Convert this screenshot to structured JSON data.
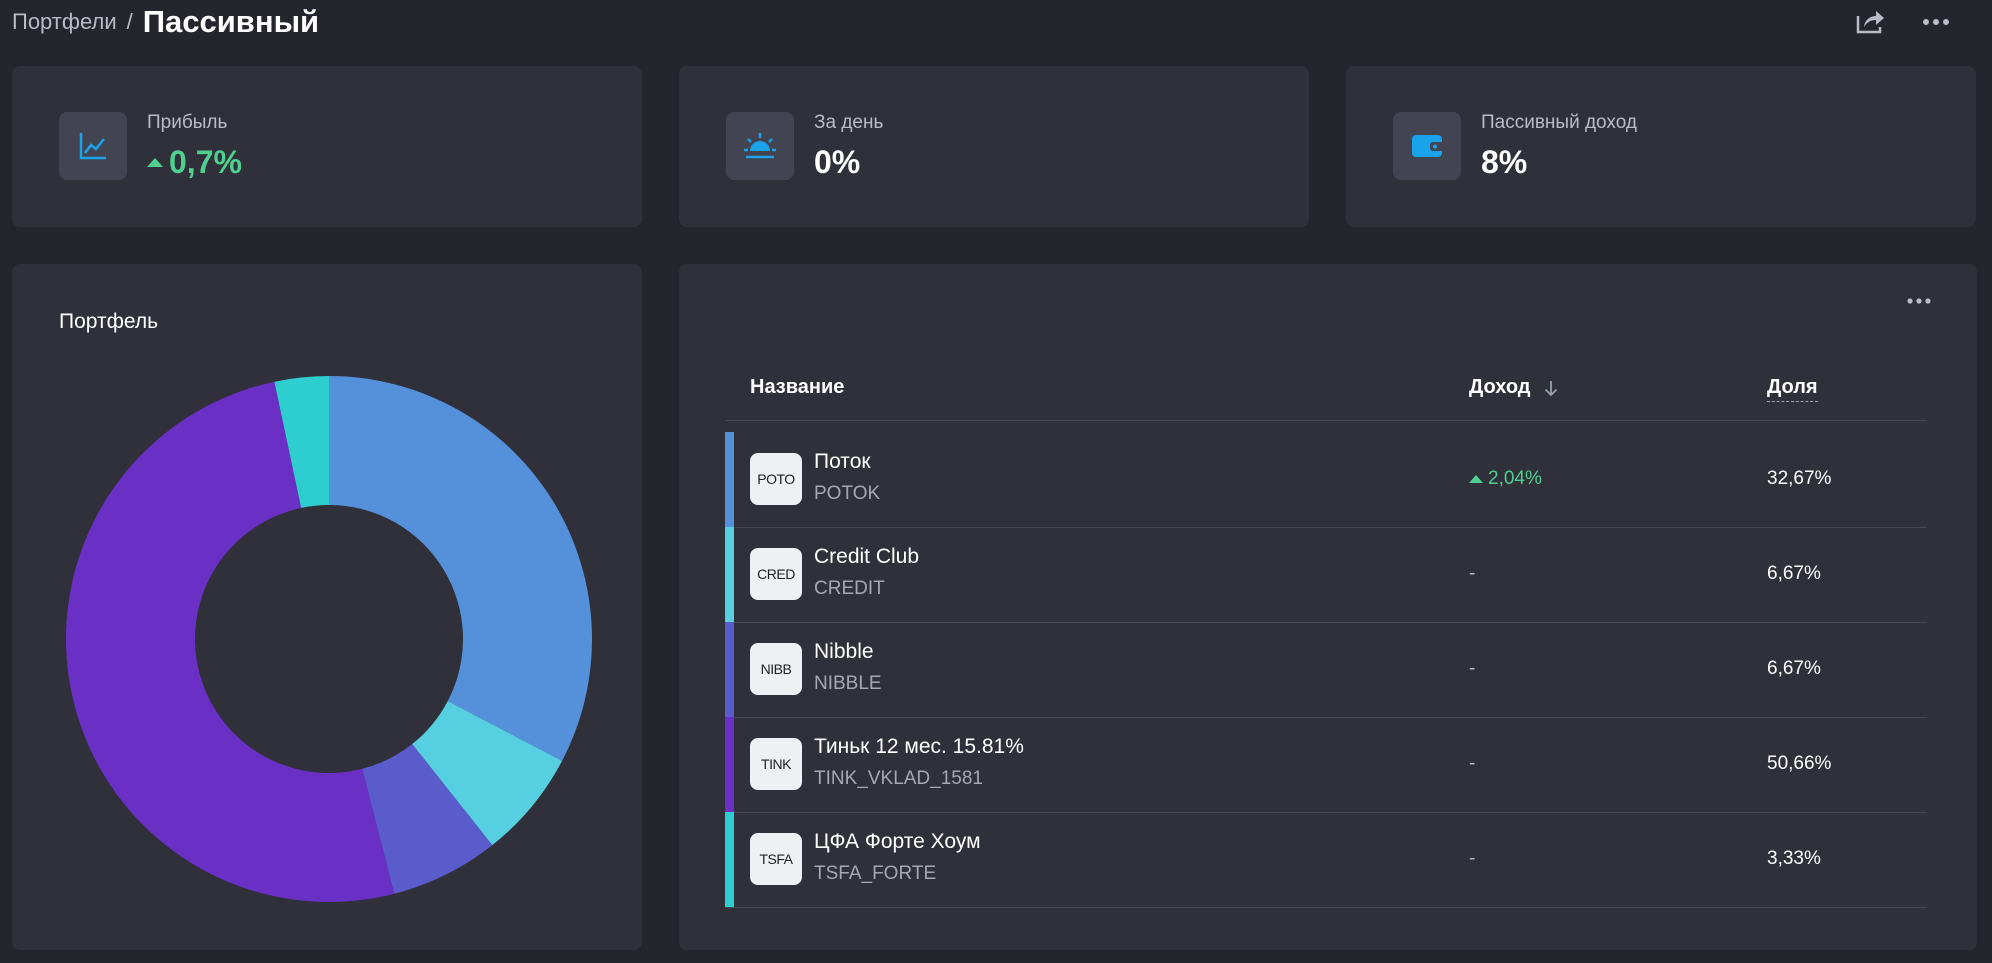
{
  "breadcrumb": {
    "parent": "Портфели",
    "separator": "/",
    "title": "Пассивный"
  },
  "header_actions": [
    {
      "name": "share-icon"
    },
    {
      "name": "more-icon"
    }
  ],
  "stats": [
    {
      "label": "Прибыль",
      "value": "0,7%",
      "icon": "chart-line-icon",
      "trend": "up",
      "color": "#4fd08e"
    },
    {
      "label": "За день",
      "value": "0%",
      "icon": "sunrise-icon"
    },
    {
      "label": "Пассивный доход",
      "value": "8%",
      "icon": "wallet-icon"
    }
  ],
  "chart": {
    "title": "Портфель",
    "chart_data": {
      "type": "pie",
      "categories": [
        "POTOK",
        "CREDIT",
        "NIBBLE",
        "TINK_VKLAD_1581",
        "TSFA_FORTE"
      ],
      "values": [
        32.67,
        6.67,
        6.67,
        50.66,
        3.33
      ],
      "colors": [
        "#5590db",
        "#56d0e0",
        "#5b5ccb",
        "#6a30c6",
        "#2ecdcf"
      ]
    }
  },
  "table": {
    "headers": {
      "name": "Название",
      "income": "Доход",
      "share": "Доля"
    },
    "rows": [
      {
        "logo": "POTO",
        "name": "Поток",
        "ticker": "POTOK",
        "income": "2,04%",
        "income_trend": "up",
        "share": "32,67%",
        "color": "#5590db"
      },
      {
        "logo": "CRED",
        "name": "Credit Club",
        "ticker": "CREDIT",
        "income": "-",
        "share": "6,67%",
        "color": "#56d0e0"
      },
      {
        "logo": "NIBB",
        "name": "Nibble",
        "ticker": "NIBBLE",
        "income": "-",
        "share": "6,67%",
        "color": "#5b5ccb"
      },
      {
        "logo": "TINK",
        "name": "Тиньк 12 мес. 15.81%",
        "ticker": "TINK_VKLAD_1581",
        "income": "-",
        "share": "50,66%",
        "color": "#6a30c6"
      },
      {
        "logo": "TSFA",
        "name": "ЦФА Форте Хоум",
        "ticker": "TSFA_FORTE",
        "income": "-",
        "share": "3,33%",
        "color": "#2ecdcf"
      }
    ]
  }
}
